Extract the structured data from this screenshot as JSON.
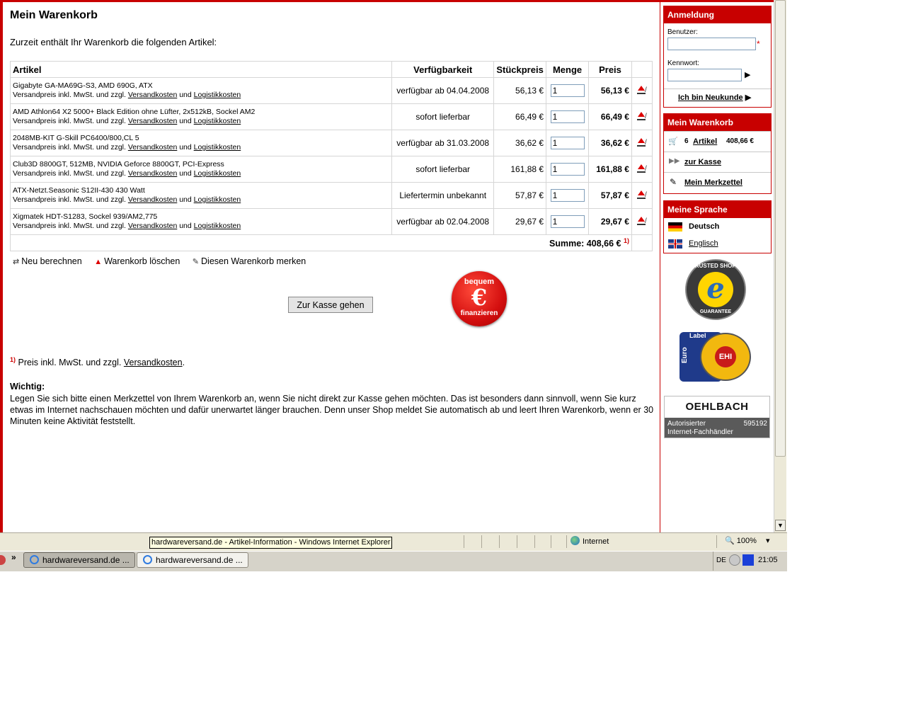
{
  "page": {
    "title": "Mein Warenkorb",
    "intro": "Zurzeit enthält Ihr Warenkorb die folgenden Artikel:"
  },
  "cart": {
    "headers": [
      "Artikel",
      "Verfügbarkeit",
      "Stückpreis",
      "Menge",
      "Preis"
    ],
    "ship_prefix": "Versandpreis inkl. MwSt. und zzgl.",
    "ship_link1": "Versandkosten",
    "ship_and": "und",
    "ship_link2": "Logistikkosten",
    "items": [
      {
        "name": "Gigabyte GA-MA69G-S3, AMD 690G, ATX",
        "avail": "verfügbar ab 04.04.2008",
        "unit": "56,13 €",
        "qty": "1",
        "total": "56,13 €"
      },
      {
        "name": "AMD Athlon64 X2 5000+ Black Edition ohne Lüfter, 2x512kB, Sockel AM2",
        "avail": "sofort lieferbar",
        "unit": "66,49 €",
        "qty": "1",
        "total": "66,49 €"
      },
      {
        "name": "2048MB-KIT G-Skill PC6400/800,CL 5",
        "avail": "verfügbar ab 31.03.2008",
        "unit": "36,62 €",
        "qty": "1",
        "total": "36,62 €"
      },
      {
        "name": "Club3D 8800GT, 512MB, NVIDIA Geforce 8800GT, PCI-Express",
        "avail": "sofort lieferbar",
        "unit": "161,88 €",
        "qty": "1",
        "total": "161,88 €"
      },
      {
        "name": "ATX-Netzt.Seasonic S12II-430 430 Watt",
        "avail": "Liefertermin unbekannt",
        "unit": "57,87 €",
        "qty": "1",
        "total": "57,87 €"
      },
      {
        "name": "Xigmatek HDT-S1283, Sockel 939/AM2,775",
        "avail": "verfügbar ab 02.04.2008",
        "unit": "29,67 €",
        "qty": "1",
        "total": "29,67 €"
      }
    ],
    "sum_label": "Summe: 408,66 €",
    "sum_footnote": "1)"
  },
  "actions": {
    "recalc": "Neu berechnen",
    "clear": "Warenkorb löschen",
    "remember": "Diesen Warenkorb merken"
  },
  "checkout_button": "Zur Kasse gehen",
  "finance_badge": {
    "top": "bequem",
    "symbol": "€",
    "bottom": "finanzieren"
  },
  "footnote": {
    "mark": "1)",
    "text": "Preis inkl. MwSt. und zzgl.",
    "link": "Versandkosten",
    "end": "."
  },
  "notice": {
    "title": "Wichtig:",
    "text": "Legen Sie sich bitte einen Merkzettel von Ihrem Warenkorb an, wenn Sie nicht direkt zur Kasse gehen möchten. Das ist besonders dann sinnvoll, wenn Sie kurz etwas im Internet nachschauen möchten und dafür unerwartet länger brauchen. Denn unser Shop meldet Sie automatisch ab und leert Ihren Warenkorb, wenn er 30 Minuten keine Aktivität feststellt."
  },
  "sidebar": {
    "login": {
      "title": "Anmeldung",
      "user_label": "Benutzer:",
      "required_mark": "*",
      "password_label": "Kennwort:",
      "submit_arrow": "▶",
      "new_customer": "Ich bin Neukunde"
    },
    "cart": {
      "title": "Mein Warenkorb",
      "count": "6",
      "articles_link": "Artikel",
      "total": "408,66 €",
      "checkout_link": "zur Kasse",
      "wishlist_link": "Mein Merkzettel"
    },
    "language": {
      "title": "Meine Sprache",
      "german": "Deutsch",
      "english": "Englisch"
    },
    "trusted_shops": {
      "top": "TRUSTED SHOPS",
      "letter": "e",
      "bottom": "GUARANTEE"
    },
    "ehi": {
      "label": "Label",
      "euro": "Euro",
      "core": "EHI"
    },
    "oehlbach": {
      "brand": "OEHLBACH",
      "line1": "Autorisierter",
      "number": "595192",
      "line2": "Internet-Fachhändler"
    }
  },
  "browser": {
    "tooltip": "hardwareversand.de - Artikel-Information - Windows Internet Explorer",
    "zone": "Internet",
    "zoom": "100%",
    "zoom_arrow": "▾"
  },
  "taskbar": {
    "more": "»",
    "tasks": [
      "hardwareversand.de ...",
      "hardwareversand.de ..."
    ],
    "lang": "DE",
    "time": "21:05"
  },
  "colors": {
    "accent": "#c80000",
    "link": "#000000"
  }
}
